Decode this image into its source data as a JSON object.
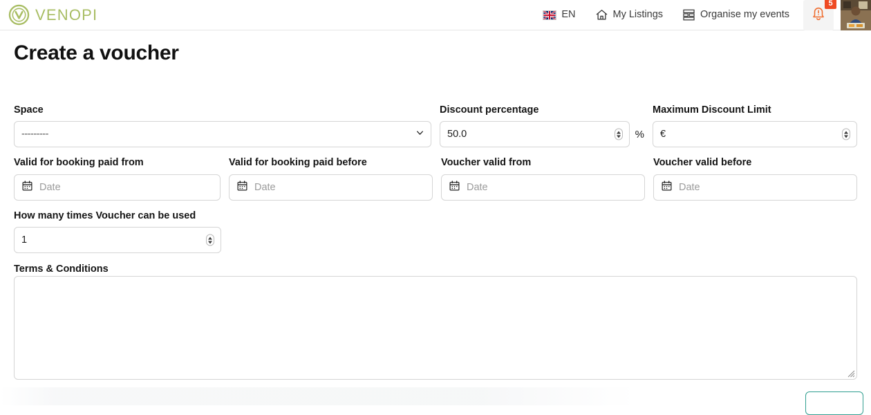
{
  "header": {
    "brand": {
      "name": "VENOPI",
      "logo_icon": "venopi-circle-v-logo",
      "color": "#a8bd63"
    },
    "nav": [
      {
        "icon": "uk-flag-icon",
        "label": "EN"
      },
      {
        "icon": "home-icon",
        "label": "My Listings"
      },
      {
        "icon": "layout-grid-icon",
        "label": "Organise my events"
      }
    ],
    "notifications": {
      "icon": "bell-alert-icon",
      "count": "5",
      "badge_color": "#ef4a23"
    },
    "avatar": {
      "icon": "user-avatar-photo"
    }
  },
  "page": {
    "title": "Create a voucher"
  },
  "form": {
    "space": {
      "label": "Space",
      "value": "---------",
      "chevron_icon": "chevron-down-icon"
    },
    "discount_percentage": {
      "label": "Discount percentage",
      "value": "50.0",
      "suffix": "%",
      "spinner_icon": "number-spinner-icon"
    },
    "maximum_discount_limit": {
      "label": "Maximum Discount Limit",
      "prefix": "€",
      "value": "",
      "spinner_icon": "number-spinner-icon"
    },
    "valid_booking_paid_from": {
      "label": "Valid for booking paid from",
      "placeholder": "Date",
      "icon": "calendar-icon"
    },
    "valid_booking_paid_before": {
      "label": "Valid for booking paid before",
      "placeholder": "Date",
      "icon": "calendar-icon"
    },
    "voucher_valid_from": {
      "label": "Voucher valid from",
      "placeholder": "Date",
      "icon": "calendar-icon"
    },
    "voucher_valid_before": {
      "label": "Voucher valid before",
      "placeholder": "Date",
      "icon": "calendar-icon"
    },
    "times_used": {
      "label": "How many times Voucher can be used",
      "value": "1",
      "spinner_icon": "number-spinner-icon"
    },
    "terms": {
      "label": "Terms & Conditions",
      "value": "",
      "resize_icon": "resize-handle-icon"
    }
  },
  "footer": {
    "submit_label": "",
    "accent_color": "#2f9e8f"
  }
}
